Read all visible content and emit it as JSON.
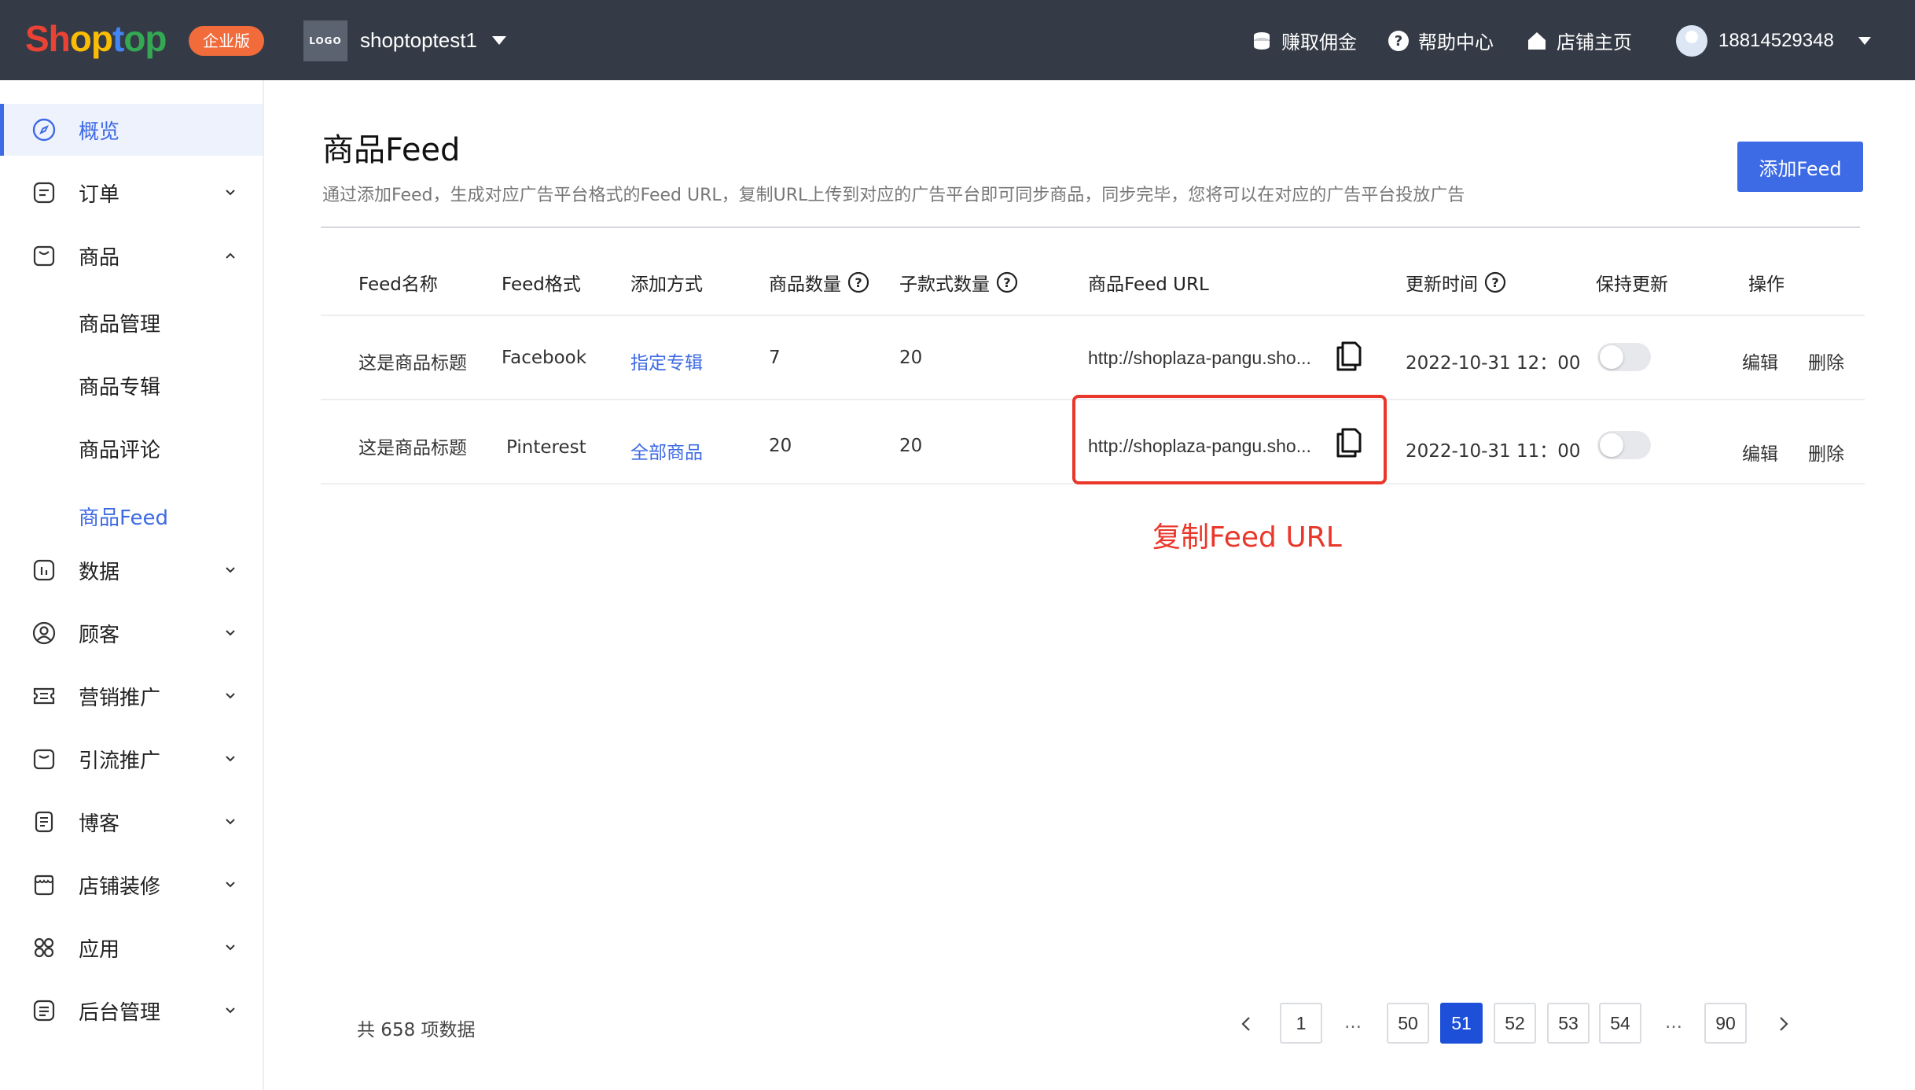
{
  "header": {
    "logo": [
      "Sh",
      "op",
      "t",
      "op"
    ],
    "edition_badge": "企业版",
    "store_logo_text": "LOGO",
    "store_name": "shoptoptest1",
    "links": [
      "赚取佣金",
      "帮助中心",
      "店铺主页"
    ],
    "user_phone": "18814529348"
  },
  "sidebar": {
    "items": [
      {
        "label": "概览"
      },
      {
        "label": "订单"
      },
      {
        "label": "商品"
      },
      {
        "label": "数据"
      },
      {
        "label": "顾客"
      },
      {
        "label": "营销推广"
      },
      {
        "label": "引流推广"
      },
      {
        "label": "博客"
      },
      {
        "label": "店铺装修"
      },
      {
        "label": "应用"
      },
      {
        "label": "后台管理"
      }
    ],
    "product_sub": [
      "商品管理",
      "商品专辑",
      "商品评论",
      "商品Feed"
    ]
  },
  "main": {
    "title": "商品Feed",
    "description": "通过添加Feed，生成对应广告平台格式的Feed URL，复制URL上传到对应的广告平台即可同步商品，同步完毕，您将可以在对应的广告平台投放广告",
    "add_button": "添加Feed",
    "columns": [
      "Feed名称",
      "Feed格式",
      "添加方式",
      "商品数量",
      "子款式数量",
      "商品Feed URL",
      "更新时间",
      "保持更新",
      "操作"
    ],
    "rows": [
      {
        "name": "这是商品标题",
        "format": "Facebook",
        "method": "指定专辑",
        "count": "7",
        "variants": "20",
        "url": "http://shoplaza-pangu.sho...",
        "updated": "2022-10-31 12：00",
        "keep_updated": false,
        "edit": "编辑",
        "delete": "删除"
      },
      {
        "name": "这是商品标题",
        "format": "Pinterest",
        "method": "全部商品",
        "count": "20",
        "variants": "20",
        "url": "http://shoplaza-pangu.sho...",
        "updated": "2022-10-31 11：00",
        "keep_updated": false,
        "edit": "编辑",
        "delete": "删除"
      }
    ],
    "annotation": "复制Feed URL"
  },
  "pagination": {
    "total": "共 658 项数据",
    "pages": [
      "1",
      "…",
      "50",
      "51",
      "52",
      "53",
      "54",
      "…",
      "90"
    ],
    "current": "51"
  },
  "colors": {
    "topbar": "#343b46",
    "accent": "#3d6ae5",
    "annotation": "#e9372a"
  }
}
